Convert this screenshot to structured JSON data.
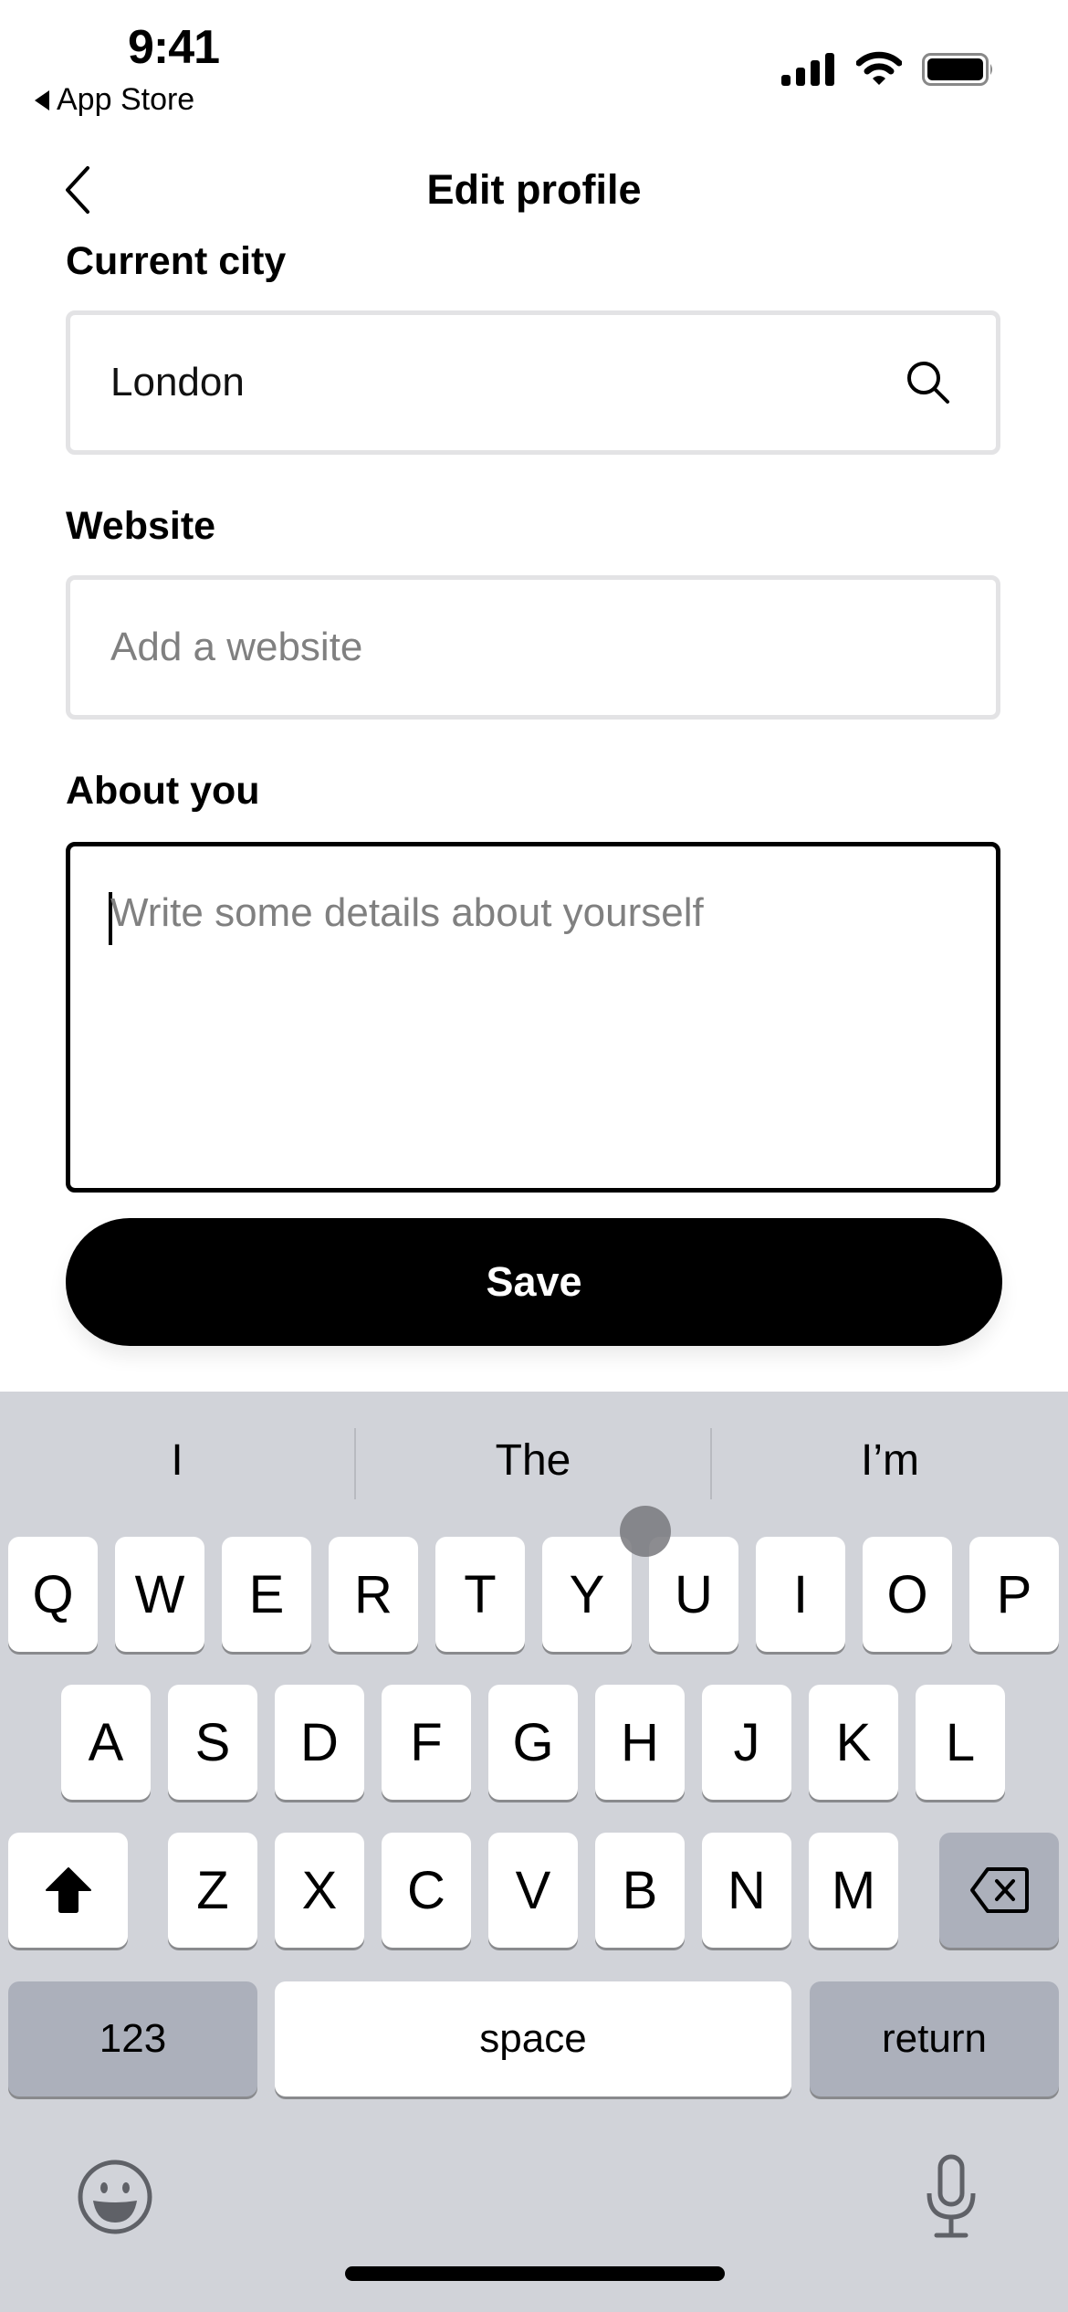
{
  "status_bar": {
    "time": "9:41",
    "back_app": "App Store",
    "icons": [
      "cellular-signal-icon",
      "wifi-icon",
      "battery-icon"
    ]
  },
  "nav": {
    "back_icon": "chevron-left-icon",
    "title": "Edit profile"
  },
  "form": {
    "city": {
      "label": "Current city",
      "value": "London",
      "icon": "search-icon"
    },
    "website": {
      "label": "Website",
      "value": "",
      "placeholder": "Add a website"
    },
    "about": {
      "label": "About you",
      "value": "",
      "placeholder": "Write some details about yourself",
      "counter_visible": "0"
    },
    "save_label": "Save"
  },
  "keyboard": {
    "suggestions": [
      "I",
      "The",
      "I’m"
    ],
    "rows": [
      [
        "Q",
        "W",
        "E",
        "R",
        "T",
        "Y",
        "U",
        "I",
        "O",
        "P"
      ],
      [
        "A",
        "S",
        "D",
        "F",
        "G",
        "H",
        "J",
        "K",
        "L"
      ],
      [
        "Z",
        "X",
        "C",
        "V",
        "B",
        "N",
        "M"
      ]
    ],
    "shift_icon": "shift-arrow-icon",
    "backspace_icon": "backspace-icon",
    "numbers_label": "123",
    "space_label": "space",
    "return_label": "return",
    "emoji_icon": "emoji-icon",
    "mic_icon": "microphone-icon"
  }
}
